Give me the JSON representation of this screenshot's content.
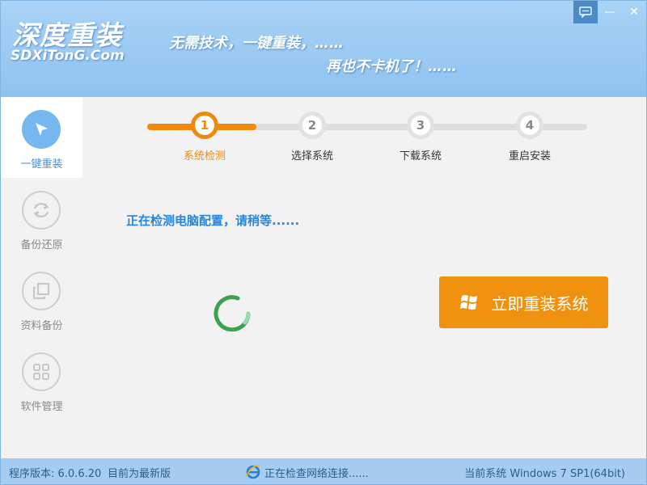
{
  "header": {
    "logo_cn": "深度重装",
    "logo_en": "SDXiTonG.Com",
    "slogan_line1": "无需技术，一键重装，……",
    "slogan_line2": "再也不卡机了！……",
    "window_buttons": {
      "feedback_icon": "chat-icon",
      "minimize": "—",
      "close": "✕"
    }
  },
  "sidebar": {
    "items": [
      {
        "label": "一键重装",
        "icon": "cursor-arrow-icon",
        "active": true
      },
      {
        "label": "备份还原",
        "icon": "sync-arrows-icon",
        "active": false
      },
      {
        "label": "资料备份",
        "icon": "copy-squares-icon",
        "active": false
      },
      {
        "label": "软件管理",
        "icon": "grid-icon",
        "active": false
      }
    ]
  },
  "steps": [
    {
      "number": "1",
      "label": "系统检测",
      "active": true
    },
    {
      "number": "2",
      "label": "选择系统",
      "active": false
    },
    {
      "number": "3",
      "label": "下载系统",
      "active": false
    },
    {
      "number": "4",
      "label": "重启安装",
      "active": false
    }
  ],
  "main": {
    "status_text": "正在检测电脑配置，请稍等......",
    "reinstall_button": "立即重装系统"
  },
  "statusbar": {
    "version": "程序版本: 6.0.6.20",
    "latest": "目前为最新版",
    "network": "正在检查网络连接......",
    "os": "当前系统 Windows 7 SP1(64bit)"
  },
  "colors": {
    "accent": "#f08a0c",
    "header_bg": "#9ccbf3",
    "link_blue": "#2a86d8",
    "spinner_green": "#2e9e47"
  }
}
